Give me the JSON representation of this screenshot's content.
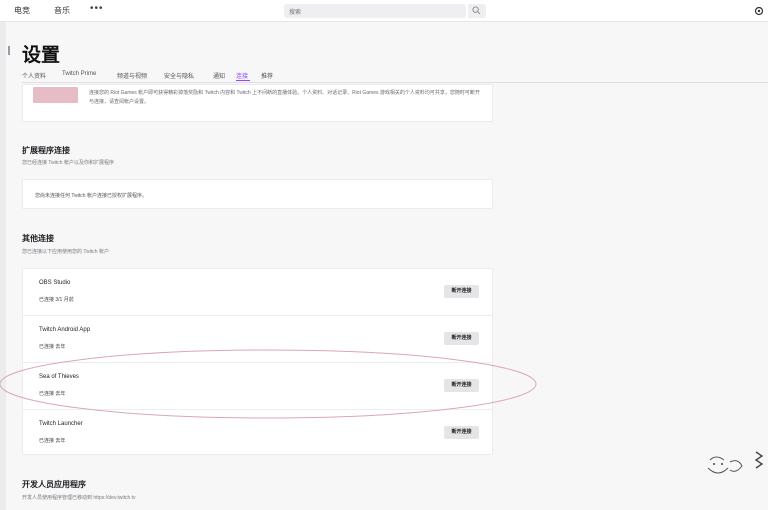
{
  "topbar": {
    "nav_items": [
      "电竞",
      "音乐"
    ],
    "more": "•••",
    "search_placeholder": "搜索"
  },
  "page": {
    "title": "设置",
    "tabs": [
      "个人资料",
      "Twitch Prime",
      "频道与视频",
      "安全与隐私",
      "通知",
      "连接",
      "推荐"
    ],
    "active_tab": "连接"
  },
  "top_card": {
    "description": "连接您的 Riot Games 帐户即可获得精彩掉落奖励和 Twitch 内容和 Twitch 上不间断的直播体验。个人资料、对话记录、Riot Games 游戏相关的个人资料均可共享，您随时可断开与连接，请查阅帐户设置。"
  },
  "extensions": {
    "title": "扩展程序连接",
    "subtitle": "您已经连接 Twitch 帐户以及你和扩展程序",
    "empty_text": "您尚未连接任何 Twitch 帐户连接已授权扩展程序。"
  },
  "other_connections": {
    "title": "其他连接",
    "subtitle": "您已连接以下应用使用您的 Twitch 帐户",
    "items": [
      {
        "name": "OBS Studio",
        "status": "已连接 3/1 月前",
        "button": "断开连接"
      },
      {
        "name": "Twitch Android App",
        "status": "已连接 去年",
        "button": "断开连接"
      },
      {
        "name": "Sea of Thieves",
        "status": "已连接 去年",
        "button": "断开连接"
      },
      {
        "name": "Twitch Launcher",
        "status": "已连接 去年",
        "button": "断开连接"
      }
    ]
  },
  "developer": {
    "title": "开发人员应用程序",
    "subtitle": "开发人员使用程序管理已移动到 https://dev.twitch.tv"
  },
  "colors": {
    "accent": "#9146ff",
    "highlight_ellipse": "#d9a8b2"
  }
}
